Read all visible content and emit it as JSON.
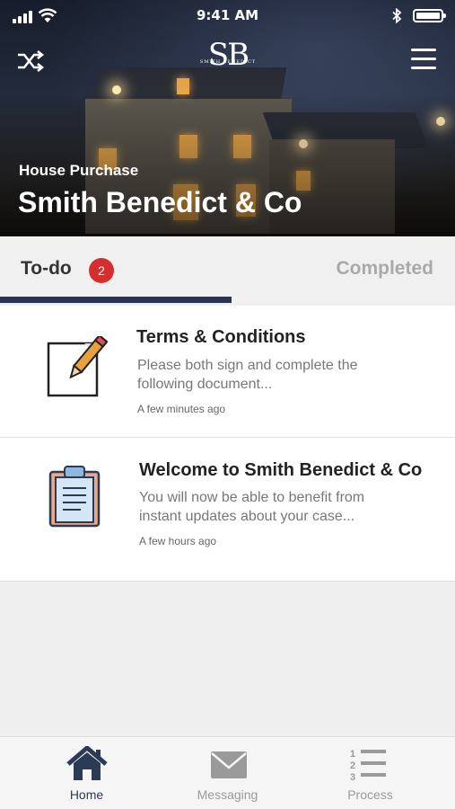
{
  "status_bar": {
    "time": "9:41 AM"
  },
  "header": {
    "logo_mark": "SB",
    "logo_sub": "SMITH BENEDICT",
    "subtitle": "House Purchase",
    "title": "Smith Benedict & Co"
  },
  "tabs": {
    "todo_label": "To-do",
    "todo_count": "2",
    "completed_label": "Completed"
  },
  "items": [
    {
      "title": "Terms & Conditions",
      "description": "Please both sign and complete the following document...",
      "time": "A few minutes ago",
      "icon": "edit-document-icon"
    },
    {
      "title": "Welcome to Smith Benedict & Co",
      "description": "You will now be able to benefit from instant updates about your case...",
      "time": "A few hours ago",
      "icon": "clipboard-icon"
    }
  ],
  "bottom_nav": [
    {
      "label": "Home",
      "icon": "home-icon",
      "active": true
    },
    {
      "label": "Messaging",
      "icon": "envelope-icon",
      "active": false
    },
    {
      "label": "Process",
      "icon": "numbered-list-icon",
      "active": false
    }
  ],
  "colors": {
    "accent": "#28354f",
    "badge": "#d62e2e",
    "inactive": "#a9a9a9"
  }
}
